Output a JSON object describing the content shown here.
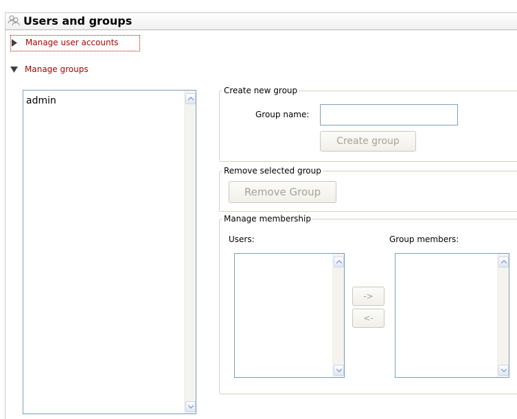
{
  "header": {
    "title": "Users and groups",
    "icon": "users-icon"
  },
  "sections": {
    "manage_user_accounts": "Manage user accounts",
    "manage_groups": "Manage groups"
  },
  "groups_list": {
    "items": [
      "admin"
    ]
  },
  "create_group": {
    "legend": "Create new group",
    "group_name_label": "Group name:",
    "group_name_value": "",
    "button_label": "Create group"
  },
  "remove_group": {
    "legend": "Remove selected group",
    "button_label": "Remove Group"
  },
  "membership": {
    "legend": "Manage membership",
    "users_label": "Users:",
    "members_label": "Group members:",
    "add_button": "->",
    "remove_button": "<-"
  },
  "colors": {
    "link": "#b00000",
    "disabled_text": "#a5a394",
    "input_border": "#7f9db9"
  }
}
